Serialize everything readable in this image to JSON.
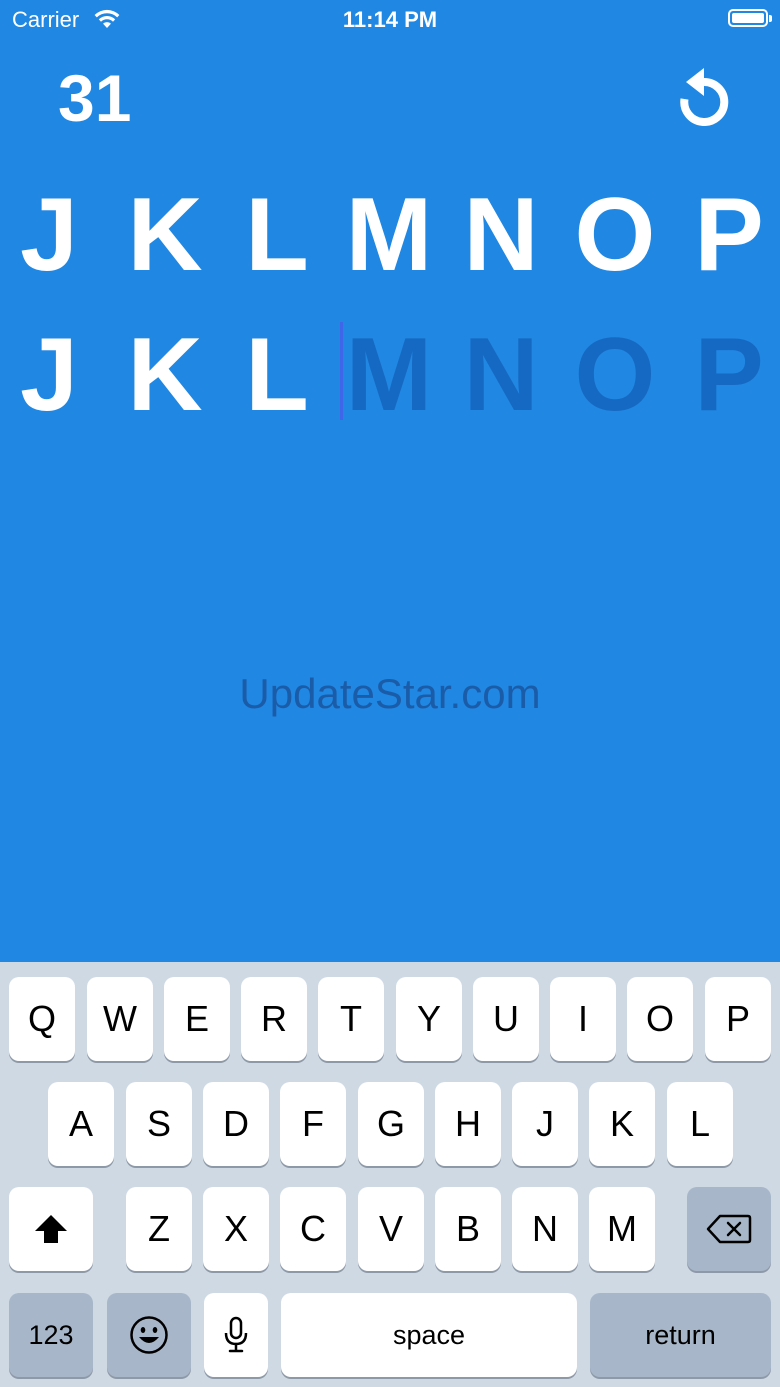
{
  "status_bar": {
    "carrier": "Carrier",
    "time": "11:14 PM"
  },
  "game": {
    "score": "31",
    "target_letters": [
      "J",
      "K",
      "L",
      "M",
      "N",
      "O",
      "P"
    ],
    "typed_letters": [
      "J",
      "K",
      "L"
    ],
    "pending_letters": [
      "M",
      "N",
      "O",
      "P"
    ]
  },
  "watermark": "UpdateStar.com",
  "keyboard": {
    "row1": [
      "Q",
      "W",
      "E",
      "R",
      "T",
      "Y",
      "U",
      "I",
      "O",
      "P"
    ],
    "row2": [
      "A",
      "S",
      "D",
      "F",
      "G",
      "H",
      "J",
      "K",
      "L"
    ],
    "row3": [
      "Z",
      "X",
      "C",
      "V",
      "B",
      "N",
      "M"
    ],
    "numbers_label": "123",
    "space_label": "space",
    "return_label": "return"
  },
  "icons": {
    "restart": "restart-icon",
    "shift": "shift-icon",
    "backspace": "backspace-icon",
    "emoji": "emoji-icon",
    "microphone": "microphone-icon",
    "wifi": "wifi-icon",
    "battery": "battery-icon"
  },
  "colors": {
    "background": "#2087E3",
    "pending_letter": "#1669C2",
    "keyboard_bg": "#CFD9E4",
    "cursor": "#3F66E8"
  }
}
